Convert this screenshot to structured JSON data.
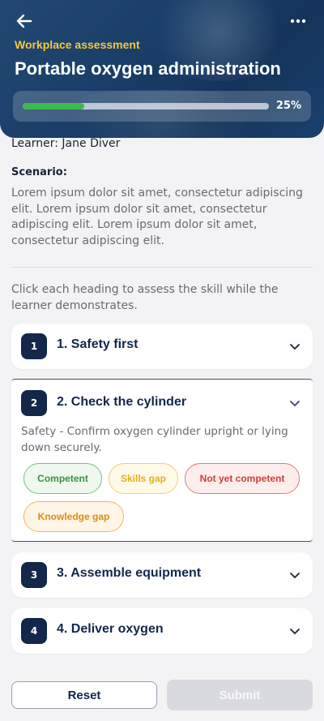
{
  "header": {
    "subtitle": "Workplace assessment",
    "title": "Portable oxygen administration",
    "progress_percent": 25,
    "progress_label": "25%",
    "back_icon": "arrow-left-icon",
    "menu_icon": "more-horizontal-icon"
  },
  "learner": "Learner: Jane Diver",
  "scenario": {
    "label": "Scenario:",
    "text": "Lorem ipsum dolor sit amet, consectetur adipiscing elit. Lorem ipsum dolor sit amet, consectetur adipiscing elit. Lorem ipsum dolor sit amet, consectetur adipiscing elit."
  },
  "instruction": "Click each heading to assess the skill while the learner demonstrates.",
  "skills": [
    {
      "num": "1",
      "title": "1. Safety first",
      "expanded": false
    },
    {
      "num": "2",
      "title": "2. Check the cylinder",
      "expanded": true,
      "description": "Safety - Confirm oxygen cylinder upright or lying down securely.",
      "options": [
        "Competent",
        "Skills gap",
        "Not yet competent",
        "Knowledge gap"
      ]
    },
    {
      "num": "3",
      "title": "3. Assemble equipment",
      "expanded": false
    },
    {
      "num": "4",
      "title": "4. Deliver oxygen",
      "expanded": false
    }
  ],
  "buttons": {
    "reset": "Reset",
    "submit": "Submit"
  },
  "colors": {
    "accent": "#12274a",
    "subtitle": "#f5c542",
    "progress": "#3fb84f",
    "competent": "#3c8f43",
    "skills_gap": "#e2b31a",
    "not_yet_competent": "#d63b3b",
    "knowledge_gap": "#e08b10"
  }
}
